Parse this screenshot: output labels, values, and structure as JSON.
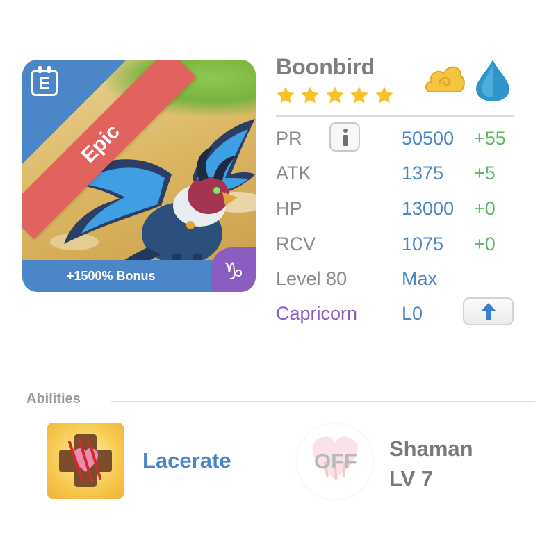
{
  "monster": {
    "name": "Boonbird",
    "stars": 5,
    "rarity": "Epic",
    "bonus": "+1500% Bonus",
    "zodiac_symbol": "♑",
    "elements": [
      "cloud-icon",
      "water-drop-icon"
    ]
  },
  "stats": {
    "pr": {
      "label": "PR",
      "value": "50500",
      "bonus": "+55"
    },
    "atk": {
      "label": "ATK",
      "value": "1375",
      "bonus": "+5"
    },
    "hp": {
      "label": "HP",
      "value": "13000",
      "bonus": "+0"
    },
    "rcv": {
      "label": "RCV",
      "value": "1075",
      "bonus": "+0"
    },
    "level": {
      "label": "Level 80",
      "value": "Max"
    },
    "zodiac": {
      "label": "Capricorn",
      "value": "L0"
    }
  },
  "abilities": {
    "title": "Abilities",
    "skill": {
      "name": "Lacerate"
    },
    "leader": {
      "status": "OFF",
      "name": "Shaman",
      "level": "LV 7"
    }
  },
  "colors": {
    "blue": "#4a86c8",
    "green": "#5cb85c",
    "purple": "#8c5dc1",
    "epic_red": "#e2635d",
    "star": "#f6c12b"
  }
}
